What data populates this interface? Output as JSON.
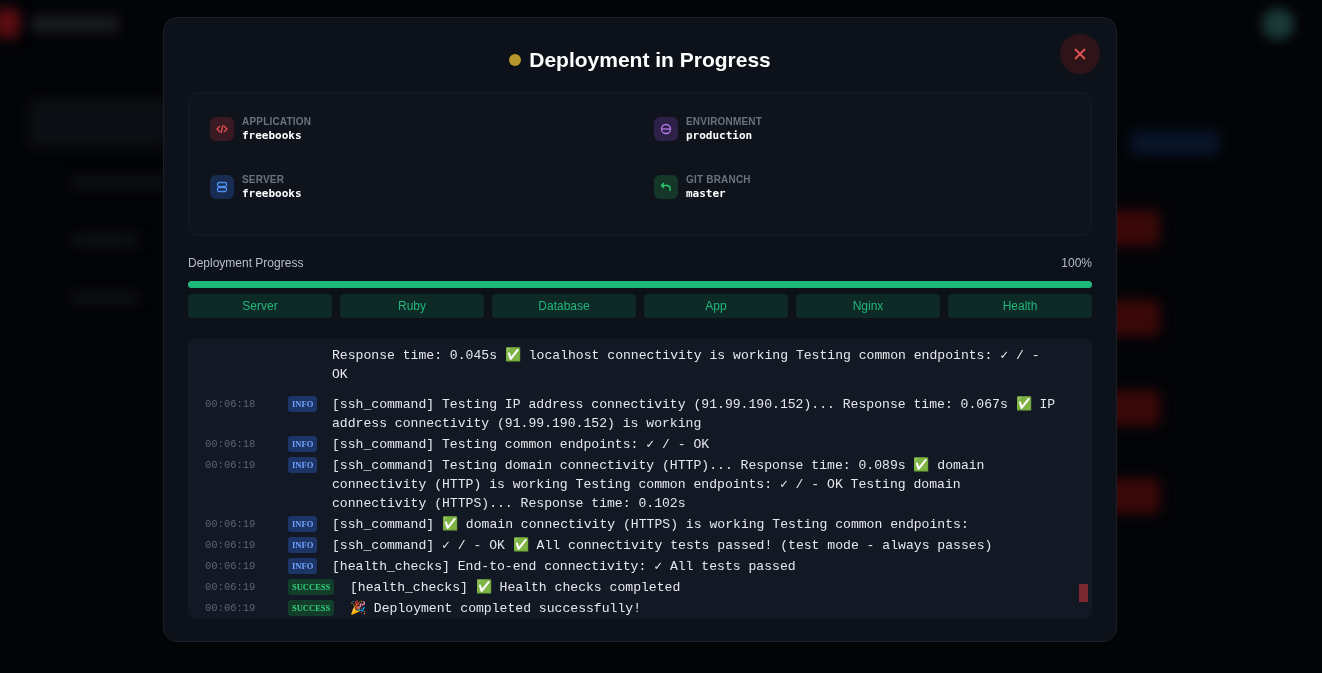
{
  "modal": {
    "title": "Deployment in Progress",
    "kind": "in_progress"
  },
  "details": [
    {
      "kind": "code",
      "label": "APPLICATION",
      "value": "freebooks"
    },
    {
      "kind": "environment",
      "label": "ENVIRONMENT",
      "value": "production"
    },
    {
      "kind": "server",
      "label": "SERVER",
      "value": "freebooks"
    },
    {
      "kind": "branch",
      "label": "GIT BRANCH",
      "value": "master"
    }
  ],
  "progress": {
    "label": "Deployment Progress",
    "percent": "100%",
    "level": 1,
    "stages": [
      {
        "label": "Server",
        "done": true
      },
      {
        "label": "Ruby",
        "done": true
      },
      {
        "label": "Database",
        "done": true
      },
      {
        "label": "App",
        "done": true
      },
      {
        "label": "Nginx",
        "done": true
      },
      {
        "label": "Health",
        "done": true
      }
    ]
  },
  "log": [
    {
      "kind": "continuation",
      "message": "Response time: 0.045s ✅ localhost connectivity is working Testing common endpoints: ✓ / - OK"
    },
    {
      "kind": "entry",
      "time": "00:06:18",
      "severity": "INFO",
      "message": "[ssh_command] Testing IP address connectivity (91.99.190.152)... Response time: 0.067s ✅ IP address connectivity (91.99.190.152) is working"
    },
    {
      "kind": "entry",
      "time": "00:06:18",
      "severity": "INFO",
      "message": "[ssh_command] Testing common endpoints: ✓ / - OK"
    },
    {
      "kind": "entry",
      "time": "00:06:19",
      "severity": "INFO",
      "message": "[ssh_command] Testing domain connectivity (HTTP)... Response time: 0.089s ✅ domain connectivity (HTTP) is working Testing common endpoints: ✓ / - OK Testing domain connectivity (HTTPS)... Response time: 0.102s"
    },
    {
      "kind": "entry",
      "time": "00:06:19",
      "severity": "INFO",
      "message": "[ssh_command] ✅ domain connectivity (HTTPS) is working Testing common endpoints:"
    },
    {
      "kind": "entry",
      "time": "00:06:19",
      "severity": "INFO",
      "message": "[ssh_command] ✓ / - OK ✅ All connectivity tests passed! (test mode - always passes)"
    },
    {
      "kind": "entry",
      "time": "00:06:19",
      "severity": "INFO",
      "message": "[health_checks] End-to-end connectivity: ✓ All tests passed"
    },
    {
      "kind": "entry",
      "time": "00:06:19",
      "severity": "SUCCESS",
      "message": "[health_checks] ✅ Health checks completed"
    },
    {
      "kind": "entry",
      "time": "00:06:19",
      "severity": "SUCCESS",
      "message": "🎉 Deployment completed successfully!"
    }
  ]
}
